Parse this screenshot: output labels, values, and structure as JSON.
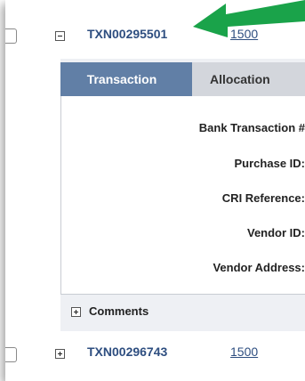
{
  "rows": [
    {
      "txn": "TXN00295501",
      "amount": "1500",
      "expanded": true
    },
    {
      "txn": "TXN00296743",
      "amount": "1500",
      "expanded": false
    }
  ],
  "tabs": {
    "active": "Transaction",
    "inactive": "Allocation"
  },
  "fields": [
    "Bank Transaction #",
    "Purchase ID:",
    "CRI Reference:",
    "Vendor ID:",
    "Vendor Address:"
  ],
  "comments": {
    "label": "Comments"
  },
  "colors": {
    "link": "#2e4e80",
    "tab_active": "#617fa6",
    "tab_inactive": "#d3d6dc",
    "arrow": "#1aa34a"
  },
  "icons": {
    "expand": "plus-box-icon",
    "collapse": "minus-box-icon",
    "arrow": "green-arrow-icon"
  }
}
